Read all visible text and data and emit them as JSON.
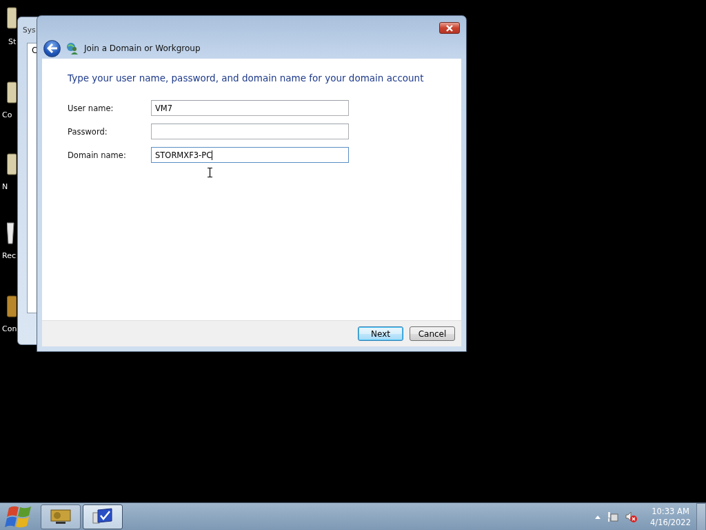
{
  "desktop_icons": [
    {
      "label": "St",
      "kind": "folder"
    },
    {
      "label": "Co",
      "kind": "folder"
    },
    {
      "label": "N",
      "kind": "folder"
    },
    {
      "label": "Rec",
      "kind": "bin"
    },
    {
      "label": "Con",
      "kind": "panel"
    }
  ],
  "background_window": {
    "title": "Sys",
    "content_text": "C"
  },
  "dialog": {
    "title": "Join a Domain or Workgroup",
    "heading": "Type your user name, password, and domain name for your domain account",
    "fields": [
      {
        "label": "User name:",
        "value": "VM7",
        "focused": false
      },
      {
        "label": "Password:",
        "focused": false
      },
      {
        "label": "Domain name:",
        "value": "STORMXF3-PC",
        "focused": true
      }
    ],
    "buttons": [
      {
        "label": "Next",
        "default": true
      },
      {
        "label": "Cancel",
        "default": false
      }
    ]
  },
  "taskbar": {
    "apps": [
      {
        "kind": "monitor",
        "active": false
      },
      {
        "kind": "system",
        "active": true
      }
    ],
    "time": "10:33 AM",
    "date": "4/16/2022"
  }
}
